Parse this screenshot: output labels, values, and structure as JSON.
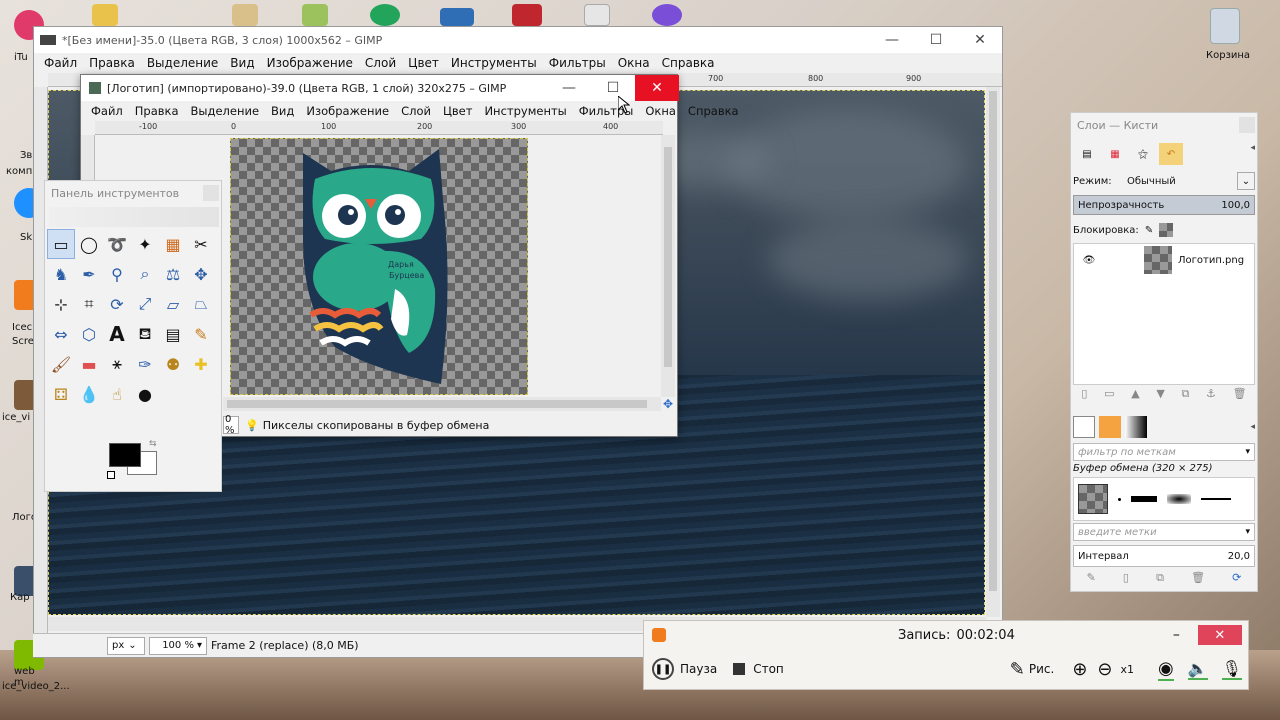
{
  "desktop": {
    "icons_right": [
      {
        "label": "Корзина"
      }
    ],
    "icons_left": [
      {
        "label": "iTu"
      },
      {
        "label": "Зв"
      },
      {
        "label": "комп"
      },
      {
        "label": "Sk"
      },
      {
        "label": "Icec"
      },
      {
        "label": "Scre"
      },
      {
        "label": "ice_vi"
      },
      {
        "label": "Лого"
      },
      {
        "label": "Кар"
      },
      {
        "label": "web m"
      },
      {
        "label": "ice_video_2..."
      }
    ]
  },
  "main_window": {
    "title": "*[Без имени]-35.0 (Цвета RGB, 3 слоя) 1000x562 – GIMP",
    "controls": {
      "minimize": "—",
      "maximize": "☐",
      "close": "✕"
    },
    "menu": [
      "Файл",
      "Правка",
      "Выделение",
      "Вид",
      "Изображение",
      "Слой",
      "Цвет",
      "Инструменты",
      "Фильтры",
      "Окна",
      "Справка"
    ],
    "ruler_labels": [
      "700",
      "800",
      "900"
    ],
    "status": {
      "unit": "px",
      "zoom": "100 %",
      "message": "Frame 2 (replace) (8,0 МБ)"
    }
  },
  "logo_window": {
    "title": "[Логотип] (импортировано)-39.0 (Цвета RGB, 1 слой) 320x275 – GIMP",
    "controls": {
      "minimize": "—",
      "maximize": "☐",
      "close": "✕"
    },
    "menu": [
      "Файл",
      "Правка",
      "Выделение",
      "Вид",
      "Изображение",
      "Слой",
      "Цвет",
      "Инструменты",
      "Фильтры",
      "Окна",
      "Справка"
    ],
    "ruler_labels": [
      "-100",
      "0",
      "100",
      "200",
      "300",
      "400"
    ],
    "owl_text_line1": "Дарья",
    "owl_text_line2": "Бурцева",
    "zoom_partial": "0 %",
    "status_message": "Пикселы скопированы в буфер обмена"
  },
  "toolbox": {
    "title": "Панель инструментов",
    "tool_icons": [
      "rect-select-icon",
      "ellipse-select-icon",
      "lasso-icon",
      "fuzzy-select-icon",
      "color-select-icon",
      "scissors-icon",
      "foreground-select-icon",
      "paths-icon",
      "color-picker-icon",
      "zoom-icon",
      "measure-icon",
      "move-icon",
      "align-icon",
      "crop-icon",
      "rotate-icon",
      "scale-icon",
      "shear-icon",
      "perspective-icon",
      "flip-icon",
      "cage-icon",
      "text-icon",
      "bucket-fill-icon",
      "blend-icon",
      "pencil-icon",
      "paintbrush-icon",
      "eraser-icon",
      "airbrush-icon",
      "ink-icon",
      "clone-icon",
      "heal-icon",
      "perspective-clone-icon",
      "blur-icon",
      "smudge-icon",
      "dodge-burn-icon"
    ],
    "fg_color": "#000000",
    "bg_color": "#ffffff"
  },
  "layers_panel": {
    "title": "Слои — Кисти",
    "mode_label": "Режим:",
    "mode_value": "Обычный",
    "opacity_label": "Непрозрачность",
    "opacity_value": "100,0",
    "lock_label": "Блокировка:",
    "layer_name": "Логотип.png",
    "brush_filter_placeholder": "фильтр по меткам",
    "brush_title": "Буфер обмена (320 × 275)",
    "tags_placeholder": "введите метки",
    "interval_label": "Интервал",
    "interval_value": "20,0"
  },
  "recorder": {
    "recording_label": "Запись:",
    "recording_time": "00:02:04",
    "pause_label": "Пауза",
    "stop_label": "Стоп",
    "draw_label": "Рис.",
    "zoom_label": "x1"
  }
}
